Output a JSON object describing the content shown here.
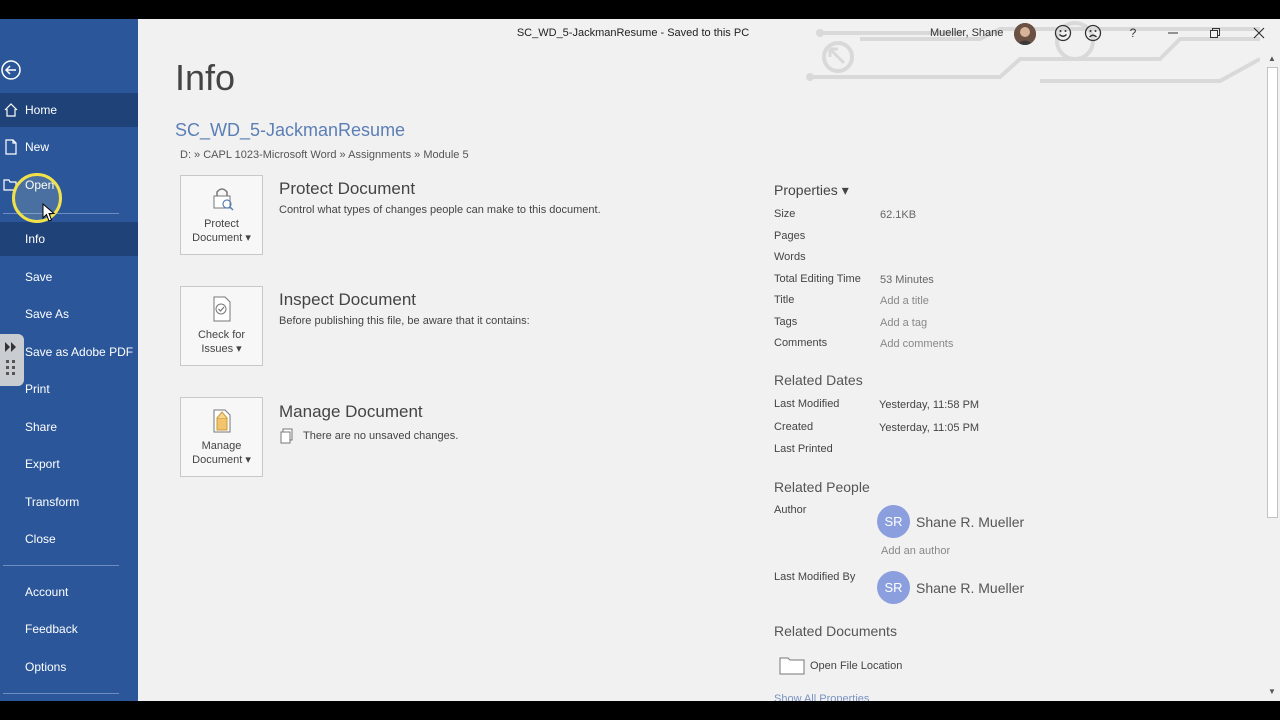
{
  "window": {
    "title": "SC_WD_5-JackmanResume  -  Saved to this PC",
    "user": "Mueller, Shane",
    "help": "?"
  },
  "sidebar": {
    "items": [
      {
        "label": "Home"
      },
      {
        "label": "New"
      },
      {
        "label": "Open"
      },
      {
        "label": "Info"
      },
      {
        "label": "Save"
      },
      {
        "label": "Save As"
      },
      {
        "label": "Save as Adobe PDF"
      },
      {
        "label": "Print"
      },
      {
        "label": "Share"
      },
      {
        "label": "Export"
      },
      {
        "label": "Transform"
      },
      {
        "label": "Close"
      },
      {
        "label": "Account"
      },
      {
        "label": "Feedback"
      },
      {
        "label": "Options"
      }
    ]
  },
  "main": {
    "title": "Info",
    "doc_name": "SC_WD_5-JackmanResume",
    "path": "D: » CAPL 1023-Microsoft Word » Assignments » Module 5",
    "actions": [
      {
        "tile_line1": "Protect",
        "tile_line2": "Document ▾",
        "heading": "Protect Document",
        "desc": "Control what types of changes people can make to this document."
      },
      {
        "tile_line1": "Check for",
        "tile_line2": "Issues ▾",
        "heading": "Inspect Document",
        "desc": "Before publishing this file, be aware that it contains:"
      },
      {
        "tile_line1": "Manage",
        "tile_line2": "Document ▾",
        "heading": "Manage Document",
        "desc": "There are no unsaved changes."
      }
    ]
  },
  "properties": {
    "heading": "Properties ▾",
    "rows": [
      {
        "label": "Size",
        "value": "62.1KB"
      },
      {
        "label": "Pages",
        "value": ""
      },
      {
        "label": "Words",
        "value": ""
      },
      {
        "label": "Total Editing Time",
        "value": "53 Minutes"
      },
      {
        "label": "Title",
        "value": "Add a title"
      },
      {
        "label": "Tags",
        "value": "Add a tag"
      },
      {
        "label": "Comments",
        "value": "Add comments"
      }
    ],
    "related_dates": {
      "heading": "Related Dates",
      "rows": [
        {
          "label": "Last Modified",
          "value": "Yesterday, 11:58 PM"
        },
        {
          "label": "Created",
          "value": "Yesterday, 11:05 PM"
        },
        {
          "label": "Last Printed",
          "value": ""
        }
      ]
    },
    "related_people": {
      "heading": "Related People",
      "author_label": "Author",
      "author_initials": "SR",
      "author_name": "Shane R. Mueller",
      "add_author": "Add an author",
      "modified_by_label": "Last Modified By",
      "modified_by_initials": "SR",
      "modified_by_name": "Shane R. Mueller"
    },
    "related_documents": {
      "heading": "Related Documents",
      "open_location": "Open File Location",
      "show_all": "Show All Properties"
    }
  },
  "colors": {
    "sidebar": "#2b579a",
    "sidebar_active": "#1f4378",
    "accent": "#5b7fb5",
    "avatar": "#8b9ede"
  }
}
